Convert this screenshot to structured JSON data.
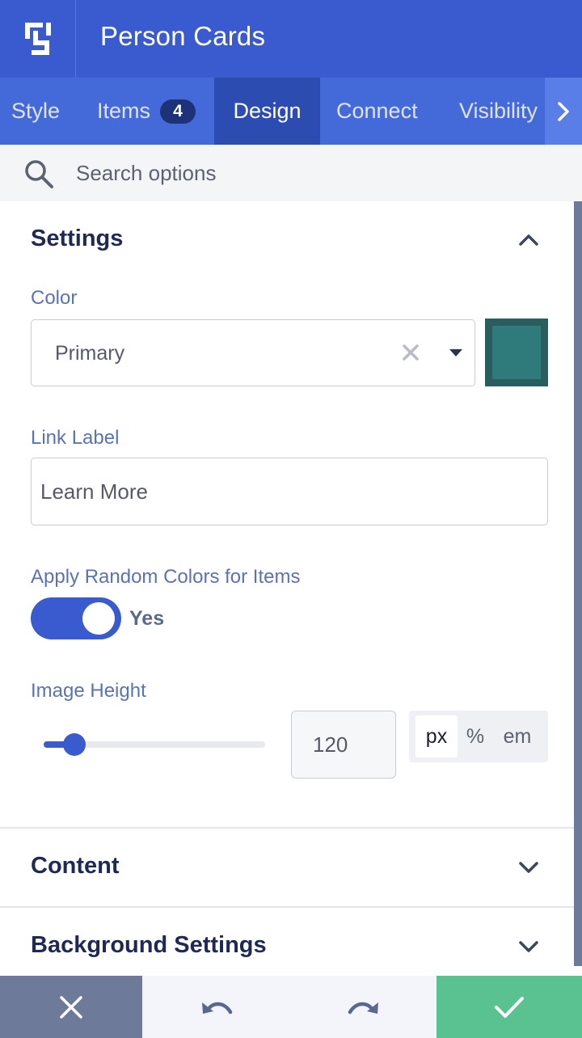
{
  "header": {
    "title": "Person Cards",
    "logo_icon": "builder-logo-icon"
  },
  "tabs": [
    {
      "label": "Style",
      "active": false
    },
    {
      "label": "Items",
      "badge": "4",
      "active": false
    },
    {
      "label": "Design",
      "active": true
    },
    {
      "label": "Connect",
      "active": false
    },
    {
      "label": "Visibility",
      "active": false
    }
  ],
  "search": {
    "placeholder": "Search options",
    "icon": "search-icon"
  },
  "settings": {
    "title": "Settings",
    "expanded": true,
    "color": {
      "label": "Color",
      "value": "Primary",
      "swatch": "#2f7a7a"
    },
    "link_label": {
      "label": "Link Label",
      "value": "Learn More"
    },
    "random_colors": {
      "label": "Apply Random Colors for Items",
      "state": "Yes",
      "on": true
    },
    "image_height": {
      "label": "Image Height",
      "value": "120",
      "slider_fraction": 0.14,
      "units": [
        "px",
        "%",
        "em"
      ],
      "selected_unit": "px"
    }
  },
  "sections": [
    {
      "title": "Content",
      "expanded": false
    },
    {
      "title": "Background Settings",
      "expanded": false
    }
  ],
  "colors": {
    "header": "#3a5bcf",
    "tabs": "#4469d8",
    "active_tab": "#2c4cb2",
    "accent": "#3a5bcf",
    "save": "#5ac190",
    "cancel": "#6e7a99"
  }
}
